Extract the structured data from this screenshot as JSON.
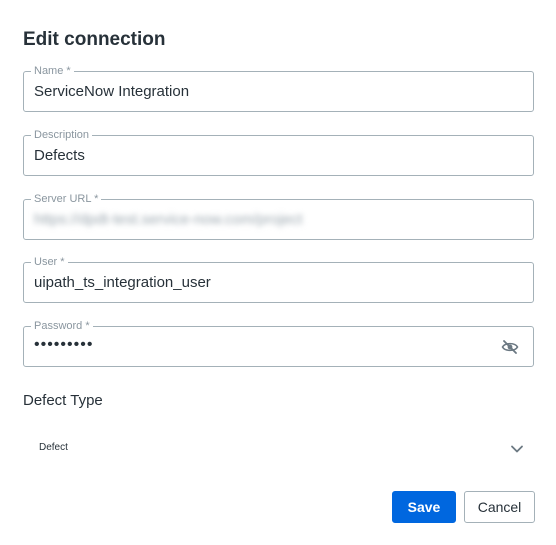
{
  "dialog": {
    "title": "Edit connection"
  },
  "fields": {
    "name": {
      "label": "Name *",
      "value": "ServiceNow Integration"
    },
    "description": {
      "label": "Description",
      "value": "Defects"
    },
    "server_url": {
      "label": "Server URL *",
      "value": "https://dpdt-test.service-now.com/project"
    },
    "user": {
      "label": "User *",
      "value": "uipath_ts_integration_user"
    },
    "password": {
      "label": "Password *",
      "value": "•••••••••",
      "toggle_icon": "eye-slash-icon"
    }
  },
  "defect_type": {
    "label": "Defect Type",
    "selected": "Defect",
    "chevron_icon": "chevron-down-icon"
  },
  "actions": {
    "save_label": "Save",
    "cancel_label": "Cancel"
  },
  "colors": {
    "primary": "#0067df",
    "text": "#273139",
    "border": "#a4b1b8",
    "muted": "#8a969f"
  }
}
